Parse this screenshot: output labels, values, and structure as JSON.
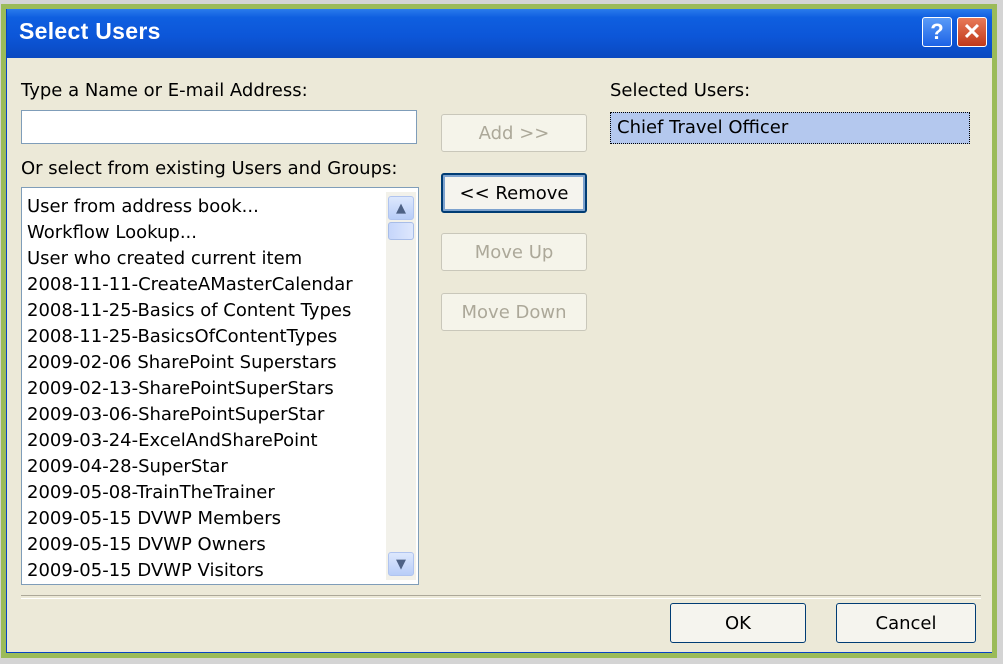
{
  "window": {
    "title": "Select Users",
    "help_label": "?",
    "close_label": "✕"
  },
  "name_input": {
    "label": "Type a Name or E-mail Address:",
    "value": "",
    "placeholder": ""
  },
  "existing": {
    "label": "Or select from existing Users and Groups:",
    "items": [
      "User from address book...",
      "Workflow Lookup...",
      "User who created current item",
      "2008-11-11-CreateAMasterCalendar",
      "2008-11-25-Basics of Content Types",
      "2008-11-25-BasicsOfContentTypes",
      "2009-02-06 SharePoint Superstars",
      "2009-02-13-SharePointSuperStars",
      "2009-03-06-SharePointSuperStar",
      "2009-03-24-ExcelAndSharePoint",
      "2009-04-28-SuperStar",
      "2009-05-08-TrainTheTrainer",
      "2009-05-15 DVWP Members",
      "2009-05-15 DVWP Owners",
      "2009-05-15 DVWP Visitors"
    ]
  },
  "buttons": {
    "add": "Add >>",
    "remove": "<< Remove",
    "move_up": "Move Up",
    "move_down": "Move Down",
    "ok": "OK",
    "cancel": "Cancel"
  },
  "selected": {
    "label": "Selected Users:",
    "items": [
      "Chief Travel Officer"
    ]
  },
  "icons": {
    "scroll_up": "▲",
    "scroll_down": "▼"
  }
}
